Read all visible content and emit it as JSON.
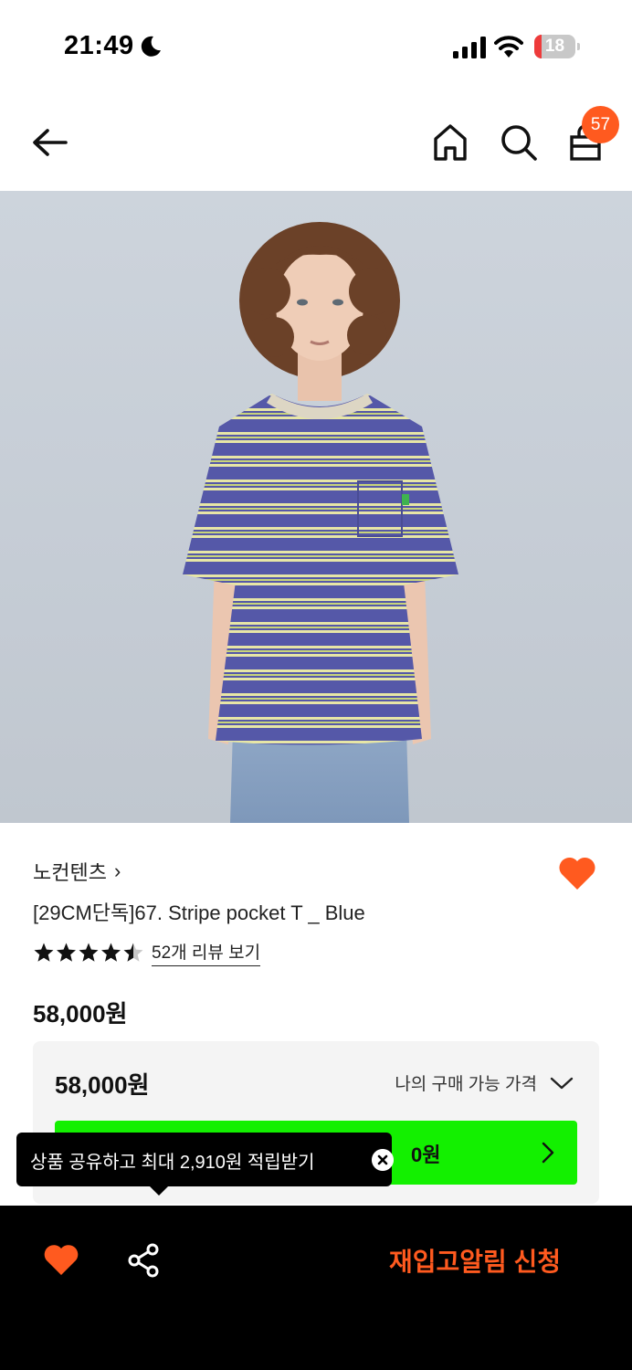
{
  "status_bar": {
    "time": "21:49",
    "battery_level": "18",
    "battery_fraction": 0.18,
    "icons": [
      "moon-icon",
      "signal-icon",
      "wifi-icon",
      "battery-icon"
    ]
  },
  "nav": {
    "icons": [
      "arrow-left-icon",
      "home-icon",
      "search-icon",
      "shopping-bag-icon"
    ],
    "cart_count": "57"
  },
  "product": {
    "brand": "노컨텐츠",
    "brand_chevron": "›",
    "title": "[29CM단독]67. Stripe pocket T _ Blue",
    "rating": 4.5,
    "review_link": "52개 리뷰 보기",
    "price": "58,000원",
    "wishlisted": true
  },
  "price_box": {
    "amount": "58,000원",
    "dropdown_label": "나의 구매 가능 가격",
    "button_text_visible": "0원"
  },
  "tooltip": {
    "text": "상품 공유하고 최대 2,910원 적립받기"
  },
  "bottom_bar": {
    "restock_label": "재입고알림 신청"
  },
  "colors": {
    "accent": "#ff5a1f",
    "green": "#13f000",
    "bottom_bar": "#000000",
    "price_box_bg": "#f4f4f4"
  }
}
